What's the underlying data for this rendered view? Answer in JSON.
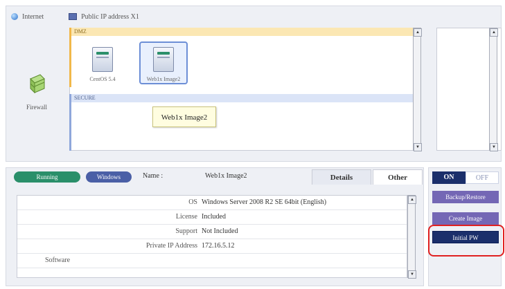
{
  "top_bar": {
    "internet_label": "Internet",
    "public_ip_label": "Public IP address X1"
  },
  "network": {
    "dmz_label": "DMZ",
    "secure_label": "SECURE",
    "firewall_label": "Firewall",
    "servers": [
      {
        "name": "CentOS 5.4"
      },
      {
        "name": "Web1x Image2"
      }
    ],
    "tooltip": "Web1x Image2"
  },
  "server_header": {
    "status": "Running",
    "os_badge": "Windows",
    "name_label": "Name :",
    "name_value": "Web1x Image2",
    "tabs": [
      "Details",
      "Other"
    ]
  },
  "details": [
    {
      "key": "OS",
      "value": "Windows Server 2008 R2 SE 64bit (English)"
    },
    {
      "key": "License",
      "value": "Included"
    },
    {
      "key": "Support",
      "value": "Not Included"
    },
    {
      "key": "Private IP Address",
      "value": "172.16.5.12"
    },
    {
      "key": "Software",
      "value": ""
    }
  ],
  "controls": {
    "on_label": "ON",
    "off_label": "OFF",
    "backup_label": "Backup/Restore",
    "create_label": "Create Image",
    "initpw_label": "Initial PW"
  }
}
